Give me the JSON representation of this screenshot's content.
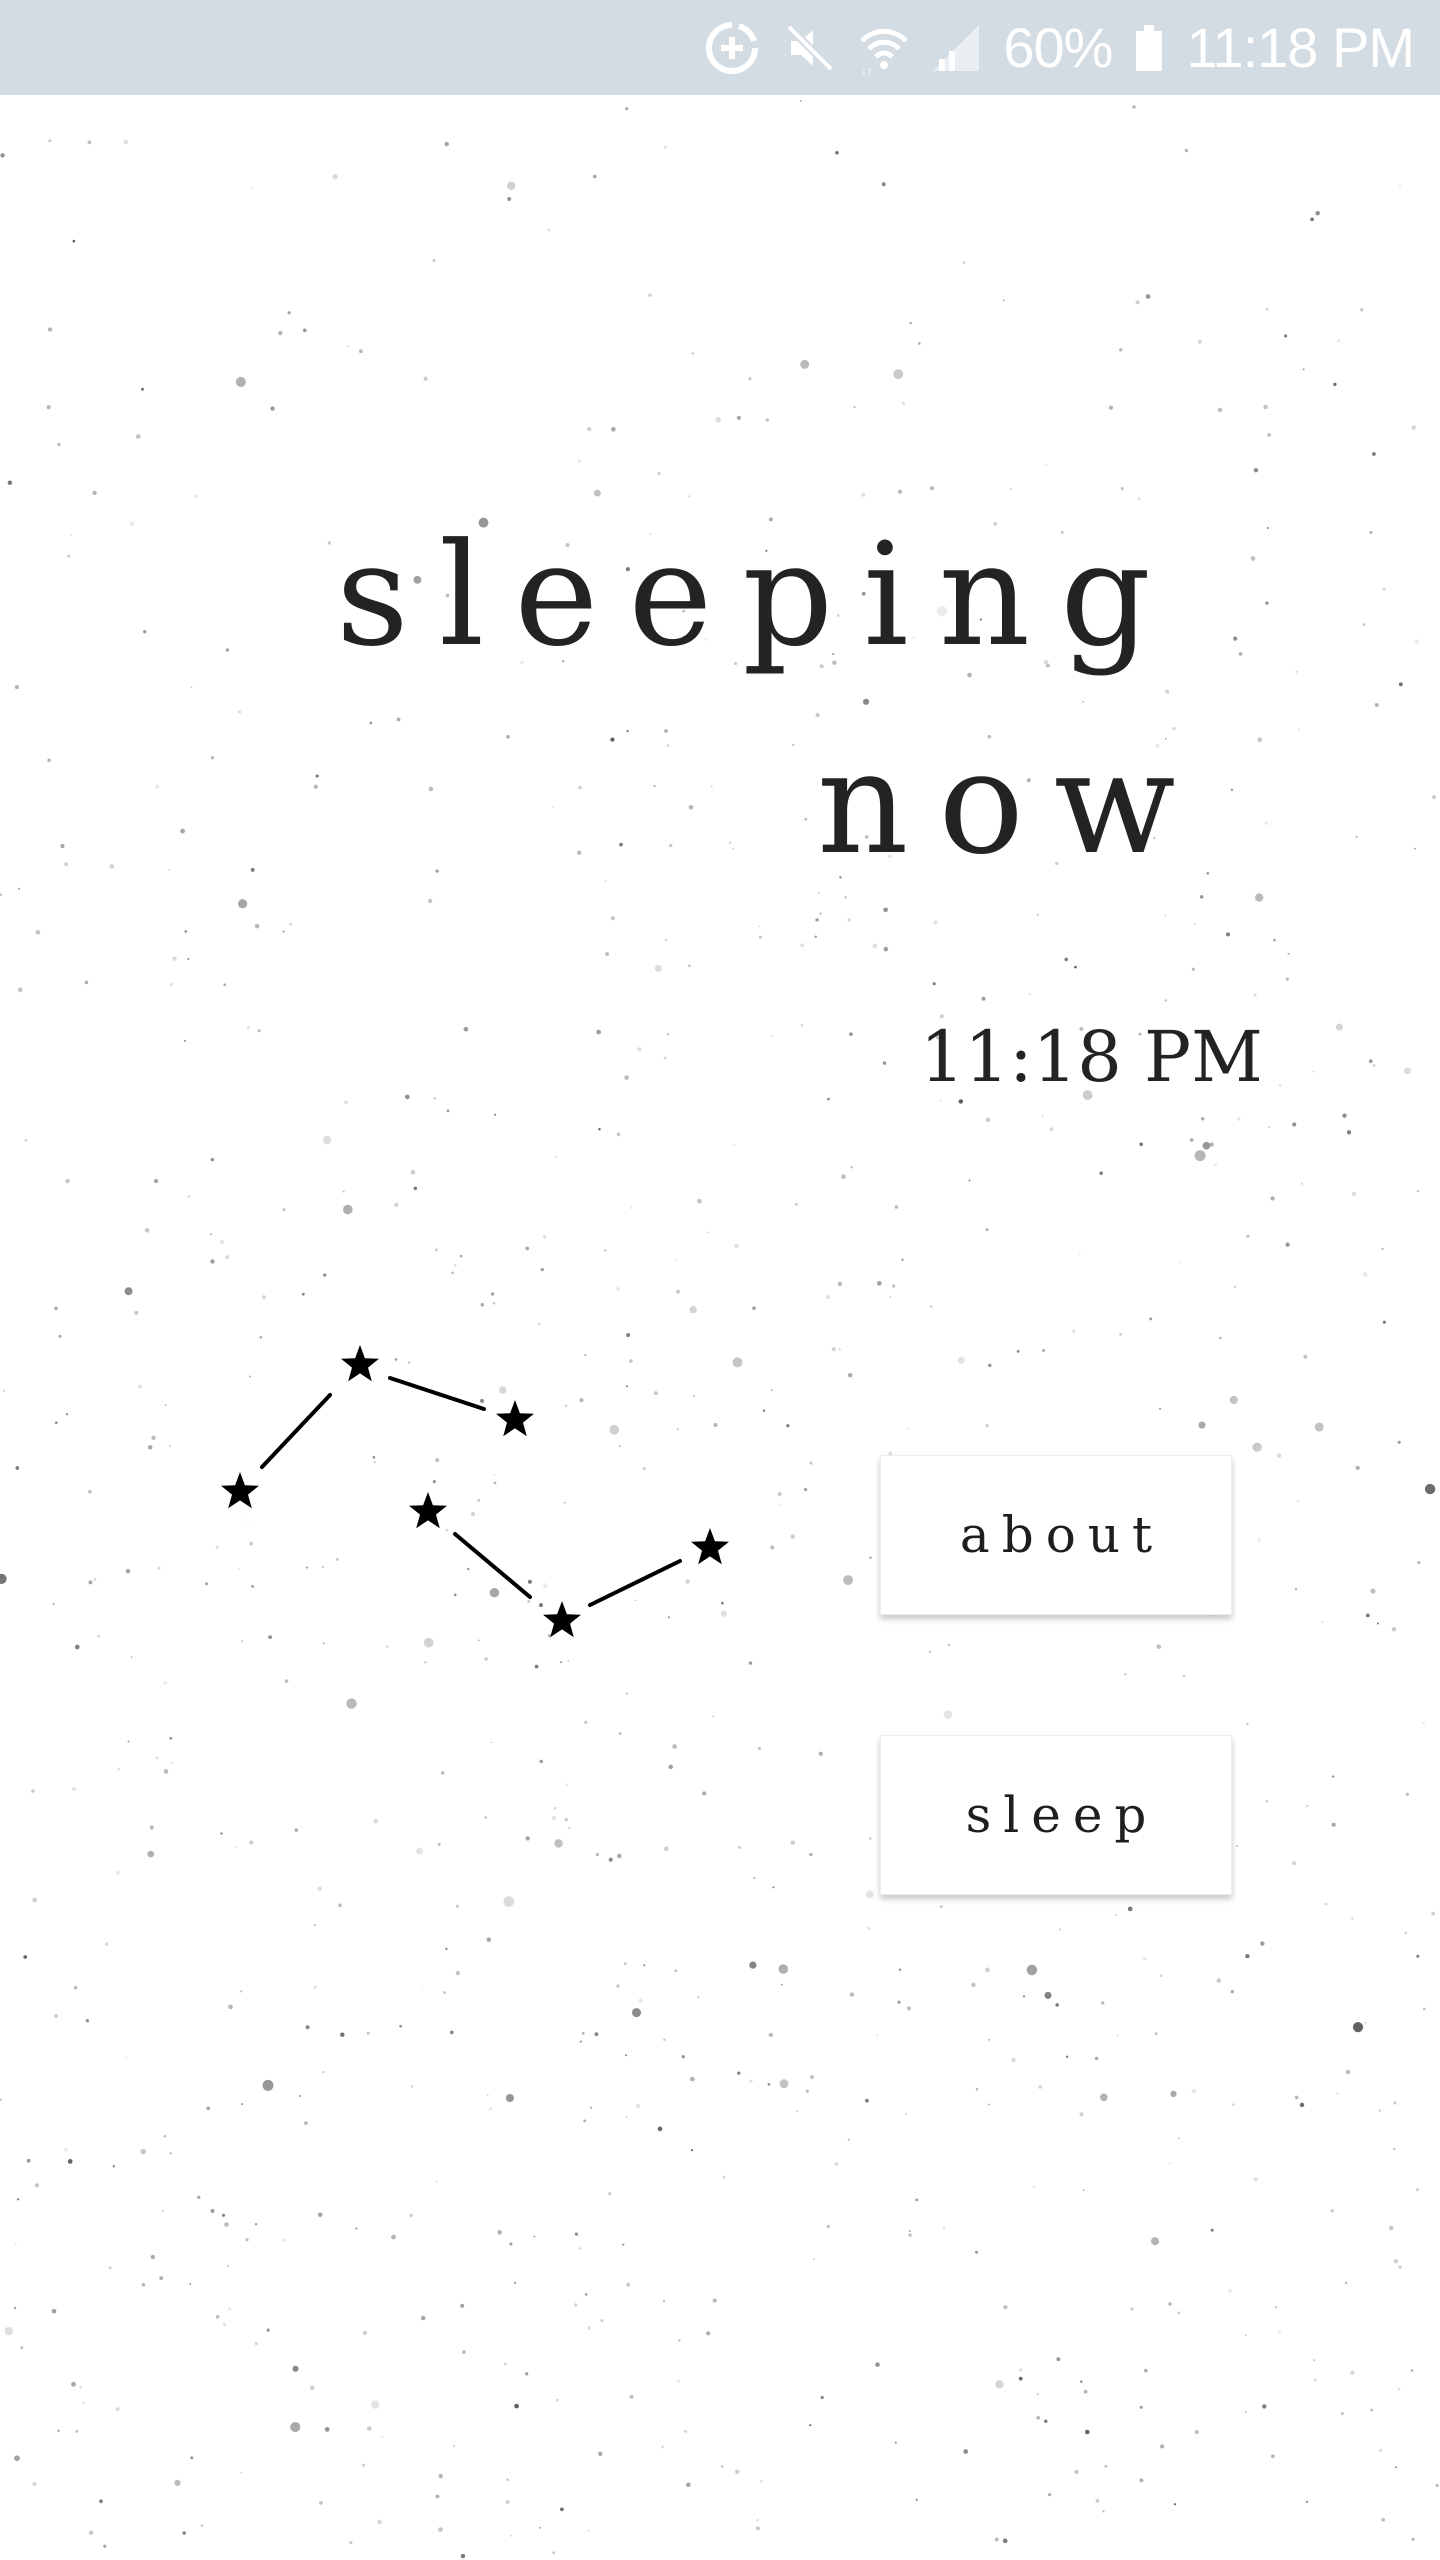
{
  "status_bar": {
    "battery_percent": "60%",
    "time": "11:18 PM",
    "icons": [
      "data-saver-icon",
      "mute-icon",
      "wifi-icon",
      "signal-icon",
      "battery-icon"
    ],
    "background_color": "#d3dbe3"
  },
  "main": {
    "title_line_1": "sleeping",
    "title_line_2": "now",
    "current_time": "11:18 PM"
  },
  "constellation": {
    "icon": "constellation-icon",
    "star_count": 6
  },
  "buttons": {
    "about_label": "about",
    "sleep_label": "sleep"
  },
  "colors": {
    "text": "#232323",
    "background": "#ffffff",
    "star": "#000000"
  }
}
